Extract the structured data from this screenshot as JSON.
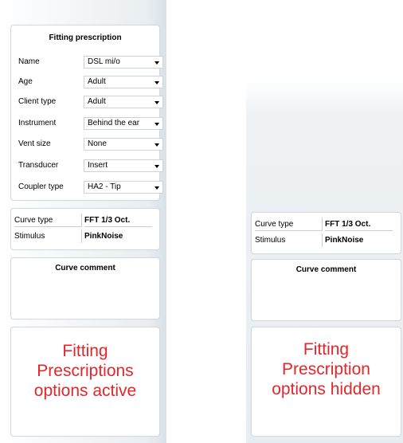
{
  "left": {
    "prescription": {
      "title": "Fitting prescription",
      "rows": [
        {
          "label": "Name",
          "value": "DSL mi/o"
        },
        {
          "label": "Age",
          "value": "Adult"
        },
        {
          "label": "Client type",
          "value": "Adult"
        },
        {
          "label": "Instrument",
          "value": "Behind the ear"
        },
        {
          "label": "Vent size",
          "value": "None"
        },
        {
          "label": "Transducer",
          "value": "Insert"
        },
        {
          "label": "Coupler type",
          "value": "HA2 - Tip"
        }
      ]
    },
    "curve": {
      "curve_type_label": "Curve type",
      "curve_type_value": "FFT 1/3 Oct.",
      "stimulus_label": "Stimulus",
      "stimulus_value": "PinkNoise"
    },
    "comment_title": "Curve comment",
    "caption": [
      "Fitting",
      "Prescriptions",
      "options active"
    ]
  },
  "right": {
    "curve": {
      "curve_type_label": "Curve type",
      "curve_type_value": "FFT 1/3 Oct.",
      "stimulus_label": "Stimulus",
      "stimulus_value": "PinkNoise"
    },
    "comment_title": "Curve comment",
    "caption": [
      "Fitting",
      "Prescription",
      "options hidden"
    ]
  },
  "colors": {
    "caption": "#e3262b",
    "panel_border": "#d3d9de"
  }
}
